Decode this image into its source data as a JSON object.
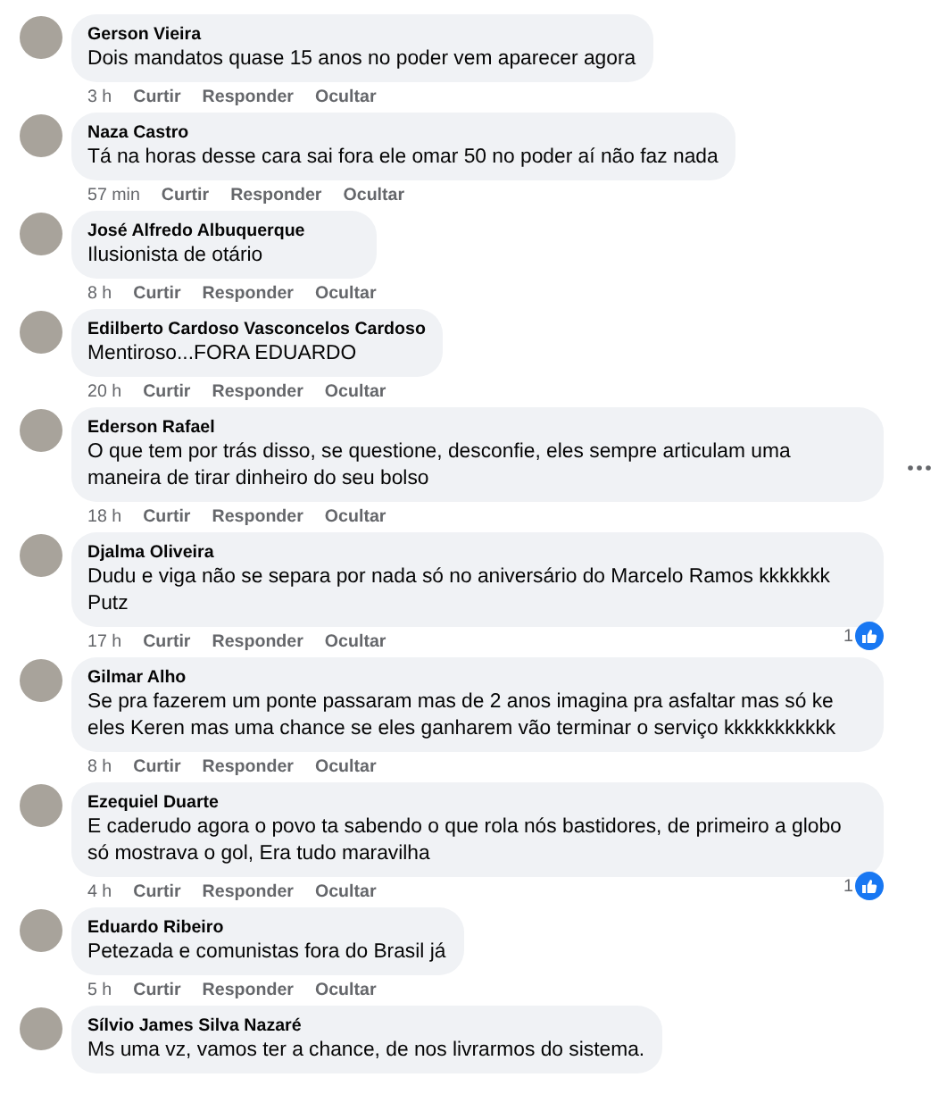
{
  "comments": [
    {
      "name": "Gerson Vieira",
      "text": "Dois mandatos quase 15 anos no poder vem aparecer agora",
      "time": "3 h",
      "actions": [
        "Curtir",
        "Responder",
        "Ocultar"
      ],
      "menu": false
    },
    {
      "name": "Naza Castro",
      "text": "Tá na horas desse cara sai fora ele omar 50 no poder aí não faz nada",
      "time": "57 min",
      "actions": [
        "Curtir",
        "Responder",
        "Ocultar"
      ],
      "menu": false
    },
    {
      "name": "José Alfredo Albuquerque",
      "text": "Ilusionista de otário",
      "time": "8 h",
      "actions": [
        "Curtir",
        "Responder",
        "Ocultar"
      ],
      "menu": false
    },
    {
      "name": "Edilberto Cardoso Vasconcelos Cardoso",
      "text": "Mentiroso...FORA EDUARDO",
      "time": "20 h",
      "actions": [
        "Curtir",
        "Responder",
        "Ocultar"
      ],
      "menu": false
    },
    {
      "name": "Ederson Rafael",
      "text": "O que tem por trás disso, se questione, desconfie, eles sempre articulam uma maneira de tirar dinheiro do seu bolso",
      "time": "18 h",
      "actions": [
        "Curtir",
        "Responder",
        "Ocultar"
      ],
      "menu": true
    },
    {
      "name": "Djalma Oliveira",
      "text": "Dudu e viga não se separa por nada só no aniversário do Marcelo Ramos kkkkkkk Putz",
      "time": "17 h",
      "actions": [
        "Curtir",
        "Responder",
        "Ocultar"
      ],
      "menu": false,
      "likes": "1"
    },
    {
      "name": "Gilmar Alho",
      "text": "Se pra fazerem um ponte passaram mas de 2 anos imagina pra asfaltar mas só ke eles Keren mas uma chance se eles ganharem vão terminar o serviço kkkkkkkkkkk",
      "time": "8 h",
      "actions": [
        "Curtir",
        "Responder",
        "Ocultar"
      ],
      "menu": false
    },
    {
      "name": "Ezequiel Duarte",
      "text": "E caderudo agora o povo ta sabendo o que rola nós bastidores, de primeiro a globo só mostrava o gol, Era tudo maravilha",
      "time": "4 h",
      "actions": [
        "Curtir",
        "Responder",
        "Ocultar"
      ],
      "menu": false,
      "likes": "1"
    },
    {
      "name": "Eduardo Ribeiro",
      "text": "Petezada e comunistas fora do Brasil já",
      "time": "5 h",
      "actions": [
        "Curtir",
        "Responder",
        "Ocultar"
      ],
      "menu": false
    },
    {
      "name": "Sílvio James Silva Nazaré",
      "text": "Ms uma vz, vamos ter a chance, de nos livrarmos do sistema.",
      "menu": false
    }
  ]
}
